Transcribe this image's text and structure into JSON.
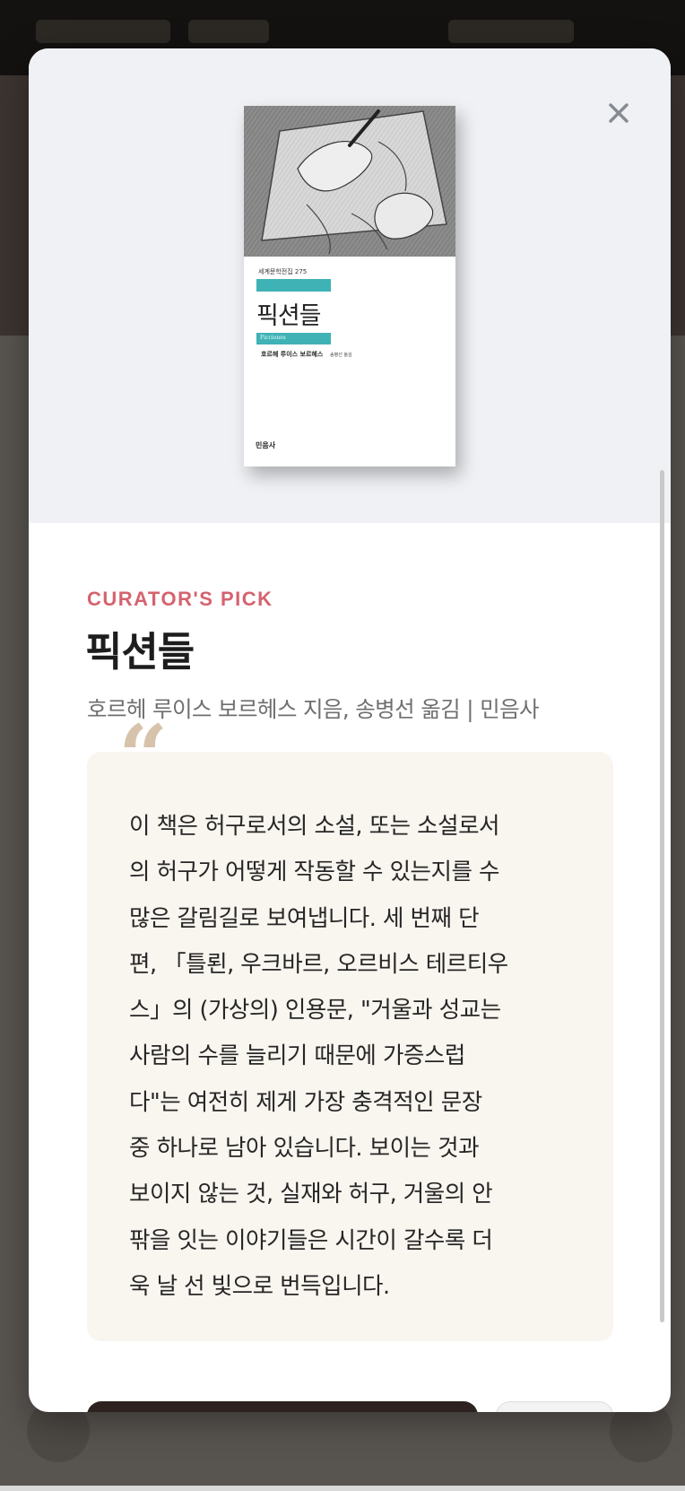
{
  "modal": {
    "close_icon": "close-icon",
    "book_cover": {
      "series": "세계문학전집 275",
      "title": "픽션들",
      "english_title": "Ficciones",
      "author": "호르헤 루이스 보르헤스",
      "translator": "송병선 옮김",
      "publisher": "민음사"
    },
    "eyebrow": "CURATOR'S PICK",
    "title": "픽션들",
    "byline": "호르헤 루이스 보르헤스 지음, 송병선 옮김 | 민음사",
    "quote_icon": "quote-icon",
    "quote_lines": [
      "이 책은 허구로서의 소설, 또는 소설로서",
      "의 허구가 어떻게 작동할 수 있는지를 수",
      "많은 갈림길로 보여냅니다. 세 번째 단",
      "편, 「틀뢴, 우크바르, 오르비스 테르티우",
      "스」의 (가상의) 인용문, \"거울과 성교는",
      "사람의 수를 늘리기 때문에 가증스럽",
      "다\"는 여전히 제게 가장 충격적인 문장",
      "중 하나로 남아 있습니다. 보이는 것과",
      "보이지 않는 것, 실재와 허구, 거울의 안",
      "팎을 잇는 이야기들은 시간이 갈수록 더",
      "욱 날 선 빛으로 번득입니다."
    ]
  },
  "colors": {
    "accent": "#d5636f",
    "quote_bg": "#f9f5ef",
    "quote_mark": "#d7c3ac",
    "cover_teal": "#3fb2b6",
    "primary_button": "#2e2220"
  }
}
